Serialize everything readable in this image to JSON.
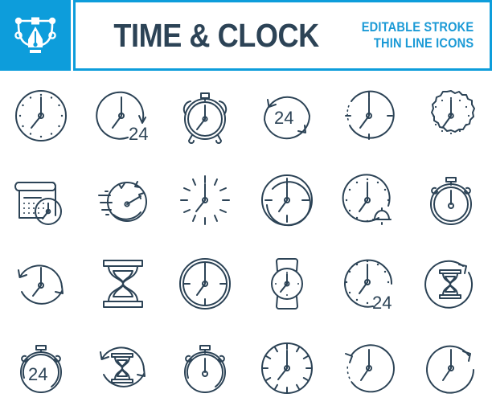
{
  "header": {
    "brand_icon": "pen-tool-icon",
    "title": "TIME & CLOCK",
    "subtitle_line1": "EDITABLE STROKE",
    "subtitle_line2": "THIN LINE ICONS",
    "brand_bg_color": "#0d9ddb",
    "title_color": "#2c4356",
    "subtitle_color": "#1b9ad6"
  },
  "grid": {
    "columns": 6,
    "rows": 4,
    "icon_stroke_color": "#2c4356",
    "background_color": "#ffffff"
  },
  "icons": [
    {
      "id": 1,
      "name": "clock-dots-icon",
      "label": "Clock with dot markers",
      "badge": ""
    },
    {
      "id": 2,
      "name": "clock-24-arrow-icon",
      "label": "Clock 24 hours with arrow",
      "badge": "24"
    },
    {
      "id": 3,
      "name": "alarm-clock-icon",
      "label": "Alarm clock with bells",
      "badge": ""
    },
    {
      "id": 4,
      "name": "circular-arrows-24-icon",
      "label": "24 hours circular arrows",
      "badge": "24"
    },
    {
      "id": 5,
      "name": "clock-ticks-dotted-arc-icon",
      "label": "Clock with ticks and dotted arc",
      "badge": ""
    },
    {
      "id": 6,
      "name": "gear-clock-icon",
      "label": "Gear shaped clock",
      "badge": ""
    },
    {
      "id": 7,
      "name": "calendar-clock-icon",
      "label": "Calendar with clock",
      "badge": ""
    },
    {
      "id": 8,
      "name": "stopwatch-speed-icon",
      "label": "Stopwatch with speed lines",
      "badge": ""
    },
    {
      "id": 9,
      "name": "clock-ticks-only-icon",
      "label": "Clock ticks without frame",
      "badge": ""
    },
    {
      "id": 10,
      "name": "clock-double-ring-icon",
      "label": "Clock with double ring",
      "badge": ""
    },
    {
      "id": 11,
      "name": "clock-alarm-bell-icon",
      "label": "Clock with alarm bell",
      "badge": ""
    },
    {
      "id": 12,
      "name": "stopwatch-icon",
      "label": "Stopwatch with top button",
      "badge": ""
    },
    {
      "id": 13,
      "name": "clock-refresh-arrows-icon",
      "label": "Clock with circular arrows",
      "badge": ""
    },
    {
      "id": 14,
      "name": "hourglass-icon",
      "label": "Hourglass sand timer",
      "badge": ""
    },
    {
      "id": 15,
      "name": "clock-ring-ticks-icon",
      "label": "Clock double ring with ticks",
      "badge": ""
    },
    {
      "id": 16,
      "name": "wristwatch-icon",
      "label": "Wrist watch",
      "badge": ""
    },
    {
      "id": 17,
      "name": "clock-24-badge-icon",
      "label": "Clock with 24 badge",
      "badge": "24"
    },
    {
      "id": 18,
      "name": "hourglass-circle-arrow-icon",
      "label": "Hourglass in circle with arrow",
      "badge": ""
    },
    {
      "id": 19,
      "name": "stopwatch-24-icon",
      "label": "Stopwatch showing 24",
      "badge": "24"
    },
    {
      "id": 20,
      "name": "hourglass-arrows-icon",
      "label": "Hourglass with circular arrows",
      "badge": ""
    },
    {
      "id": 21,
      "name": "stopwatch-plain-icon",
      "label": "Plain stopwatch",
      "badge": ""
    },
    {
      "id": 22,
      "name": "clock-tickmarks-icon",
      "label": "Clock with tick marks",
      "badge": ""
    },
    {
      "id": 23,
      "name": "clock-dotted-arc-arrow-icon",
      "label": "Clock dotted arc with arrow",
      "badge": ""
    },
    {
      "id": 24,
      "name": "clock-arrow-icon",
      "label": "Clock with arrow",
      "badge": ""
    }
  ]
}
